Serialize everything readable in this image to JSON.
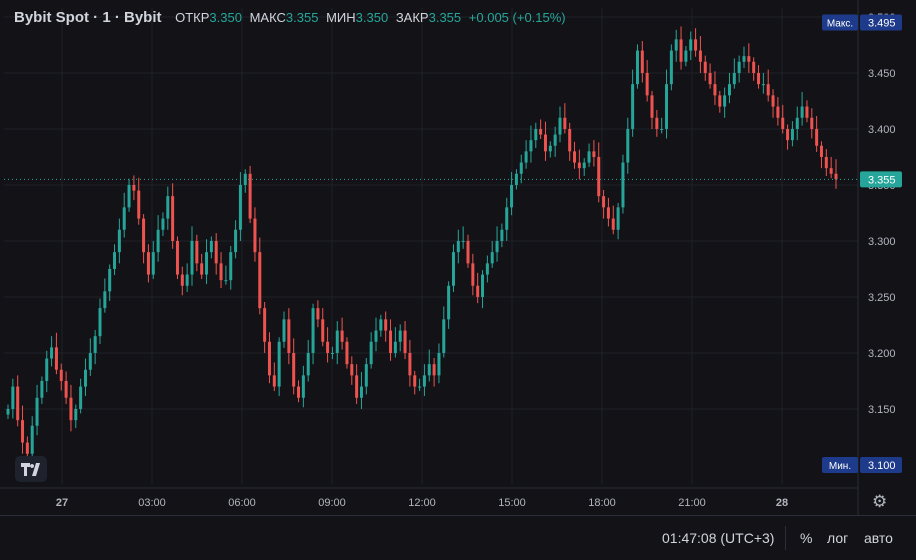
{
  "legend": {
    "symbol": "Bybit Spot · 1 · Bybit",
    "open_label": "ОТКР",
    "open": "3.350",
    "high_label": "МАКС",
    "high": "3.355",
    "low_label": "МИН",
    "low": "3.350",
    "close_label": "ЗАКР",
    "close": "3.355",
    "change": "+0.005 (+0.15%)"
  },
  "toolbar": {
    "clock": "01:47:08 (UTC+3)",
    "percent": "%",
    "log": "лог",
    "auto": "авто"
  },
  "colors": {
    "up": "#26a69a",
    "down": "#ef5350",
    "background": "#131317",
    "grid": "#1f2128",
    "text": "#d1d4dc"
  },
  "chart_data": {
    "type": "candlestick",
    "x_ticks": [
      "27",
      "03:00",
      "06:00",
      "09:00",
      "12:00",
      "15:00",
      "18:00",
      "21:00",
      "28"
    ],
    "y_ticks": [
      "3.150",
      "3.200",
      "3.250",
      "3.300",
      "3.350",
      "3.400",
      "3.450",
      "3.500"
    ],
    "ylim": [
      3.083,
      3.508
    ],
    "grid": true,
    "markers": [
      {
        "label": "Макс.",
        "value": "3.495"
      },
      {
        "label": "Мин.",
        "value": "3.100"
      },
      {
        "label": "",
        "value": "3.355"
      }
    ],
    "series": [
      {
        "values": [
          3.15,
          3.17,
          3.14,
          3.12,
          3.11,
          3.135,
          3.16,
          3.175,
          3.195,
          3.205,
          3.185,
          3.175,
          3.16,
          3.14,
          3.15,
          3.17,
          3.185,
          3.2,
          3.215,
          3.24,
          3.255,
          3.275,
          3.29,
          3.31,
          3.33,
          3.35,
          3.345,
          3.32,
          3.29,
          3.27,
          3.29,
          3.31,
          3.32,
          3.34,
          3.3,
          3.27,
          3.26,
          3.27,
          3.3,
          3.28,
          3.27,
          3.29,
          3.3,
          3.28,
          3.265,
          3.265,
          3.29,
          3.31,
          3.35,
          3.36,
          3.32,
          3.29,
          3.24,
          3.21,
          3.18,
          3.17,
          3.21,
          3.23,
          3.2,
          3.17,
          3.16,
          3.18,
          3.2,
          3.24,
          3.23,
          3.21,
          3.2,
          3.2,
          3.22,
          3.21,
          3.19,
          3.18,
          3.16,
          3.17,
          3.19,
          3.21,
          3.22,
          3.23,
          3.22,
          3.2,
          3.21,
          3.22,
          3.2,
          3.18,
          3.17,
          3.17,
          3.18,
          3.19,
          3.18,
          3.2,
          3.23,
          3.26,
          3.29,
          3.3,
          3.3,
          3.28,
          3.26,
          3.25,
          3.27,
          3.28,
          3.29,
          3.3,
          3.31,
          3.33,
          3.35,
          3.36,
          3.37,
          3.38,
          3.39,
          3.4,
          3.395,
          3.38,
          3.385,
          3.395,
          3.41,
          3.4,
          3.38,
          3.37,
          3.365,
          3.37,
          3.38,
          3.375,
          3.34,
          3.33,
          3.32,
          3.31,
          3.33,
          3.37,
          3.4,
          3.44,
          3.47,
          3.45,
          3.43,
          3.41,
          3.4,
          3.4,
          3.44,
          3.47,
          3.48,
          3.46,
          3.47,
          3.48,
          3.47,
          3.46,
          3.45,
          3.44,
          3.43,
          3.42,
          3.43,
          3.44,
          3.45,
          3.46,
          3.465,
          3.46,
          3.45,
          3.44,
          3.44,
          3.43,
          3.42,
          3.41,
          3.4,
          3.39,
          3.4,
          3.41,
          3.42,
          3.41,
          3.4,
          3.385,
          3.375,
          3.365,
          3.36,
          3.355
        ]
      }
    ]
  }
}
